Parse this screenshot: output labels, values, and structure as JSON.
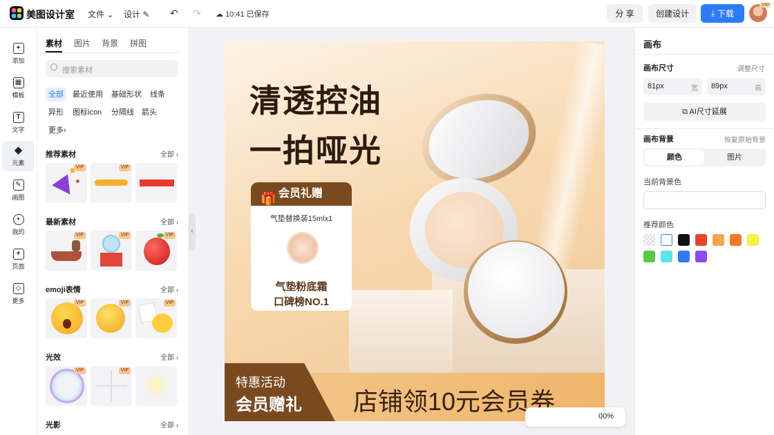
{
  "topbar": {
    "app_name": "美图设计室",
    "menu_file": "文件",
    "menu_design": "设计",
    "save_status": "10:41 已保存",
    "share_label": "分 享",
    "create_label": "创建设计",
    "download_label": "下载",
    "avatar_badge": "VIP"
  },
  "rail": {
    "items": [
      {
        "label": "添加",
        "icon": "plus-icon"
      },
      {
        "label": "模板",
        "icon": "template-icon"
      },
      {
        "label": "文字",
        "icon": "text-icon"
      },
      {
        "label": "元素",
        "icon": "shapes-icon"
      },
      {
        "label": "画图",
        "icon": "draw-icon"
      },
      {
        "label": "我的",
        "icon": "user-icon"
      },
      {
        "label": "页面",
        "icon": "page-icon"
      },
      {
        "label": "更多",
        "icon": "cube-icon"
      }
    ],
    "active": "元素"
  },
  "panel": {
    "tabs": [
      "素材",
      "图片",
      "背景",
      "拼图"
    ],
    "search_placeholder": "搜索素材",
    "chips": [
      "全部",
      "最近使用",
      "基础形状",
      "线条",
      "异形",
      "图标icon",
      "分隔线",
      "箭头",
      "更多"
    ],
    "all_label": "全部",
    "vip_label": "VIP",
    "sections": [
      "推荐素材",
      "最新素材",
      "emoji表情",
      "光效",
      "光影"
    ]
  },
  "canvas": {
    "title_line1": "清透控油",
    "title_line2": "一拍哑光",
    "gift_title": "会员礼赠",
    "gift_sub": "气垫替换装15mlx1",
    "gift_line1": "气垫粉底霜",
    "gift_line2": "口碑榜NO.1",
    "band_small": "特惠活动",
    "band_big": "会员赠礼",
    "band_right": "店铺领10元会员券",
    "zoom": "00%"
  },
  "right_panel": {
    "title": "画布",
    "size_label": "画布尺寸",
    "resize_link": "调整尺寸",
    "width_value": "81px",
    "width_suffix": "宽",
    "height_value": "89px",
    "height_suffix": "高",
    "ai_expand": "AI尺寸延展",
    "bg_label": "画布背景",
    "restore_link": "恢复原始背景",
    "seg_color": "颜色",
    "seg_image": "图片",
    "current_bg_label": "当前背景色",
    "recommended_label": "推荐颜色",
    "swatches": [
      "transparent",
      "#ffffff",
      "#111111",
      "#e8432a",
      "#f5a54a",
      "#f07a2a",
      "#f4f04a",
      "#55cc45",
      "#5ee6e6",
      "#2b7cf6",
      "#8b4cf0"
    ]
  },
  "colors": {
    "accent": "#2b7cf6",
    "brand_brown": "#7a4a1f"
  }
}
